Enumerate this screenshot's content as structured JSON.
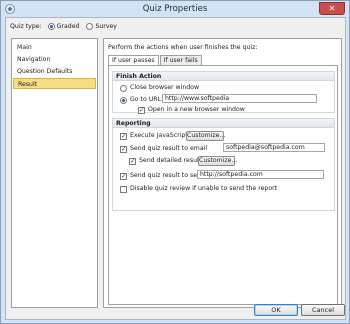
{
  "window": {
    "title": "Quiz Properties",
    "close_glyph": "✕"
  },
  "quiz_type": {
    "label": "Quiz type:",
    "options": [
      "Graded",
      "Survey"
    ],
    "selected": "Graded"
  },
  "nav": {
    "items": [
      "Main",
      "Navigation",
      "Question Defaults",
      "Result"
    ],
    "selected": "Result"
  },
  "content": {
    "heading": "Perform the actions when user finishes the quiz:",
    "tabs": [
      "If user passes",
      "If user fails"
    ],
    "active_tab": "If user passes",
    "finish_action": {
      "title": "Finish Action",
      "close_browser": "Close browser window",
      "go_to_url": "Go to URL:",
      "url_value": "http://www.softpedia",
      "open_new_window": "Open in a new browser window"
    },
    "reporting": {
      "title": "Reporting",
      "execute_js": "Execute JavaScript",
      "customize_1": "Customize...",
      "send_email": "Send quiz result to email",
      "email_value": "softpedia@softpedia.com",
      "send_detailed": "Send detailed results",
      "customize_2": "Customize...",
      "send_server": "Send quiz result to server",
      "server_value": "http://softpedia.com",
      "disable_review": "Disable quiz review if unable to send the report"
    }
  },
  "footer": {
    "ok": "OK",
    "cancel": "Cancel"
  }
}
